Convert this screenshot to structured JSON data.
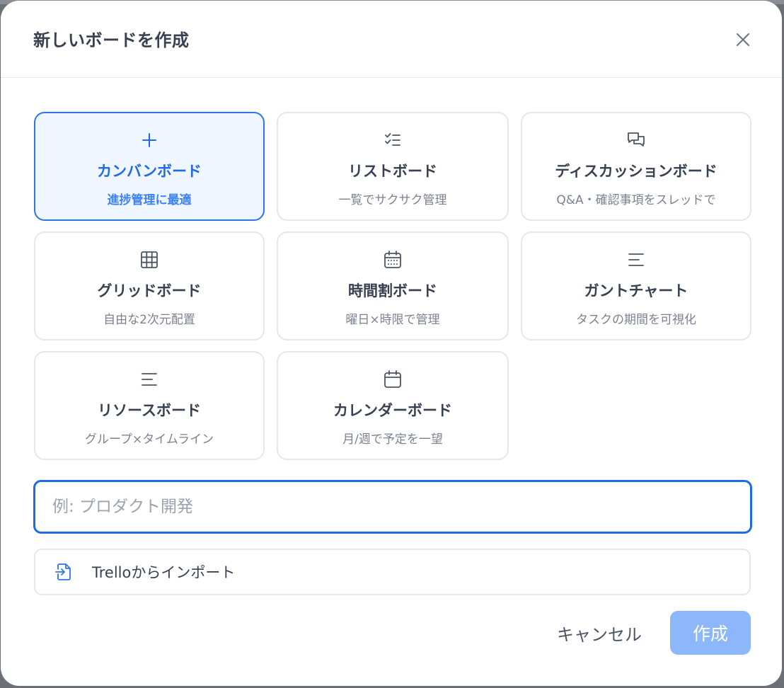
{
  "dialog": {
    "title": "新しいボードを作成"
  },
  "board_types": [
    {
      "title": "カンバンボード",
      "subtitle": "進捗管理に最適",
      "icon": "plus-icon",
      "selected": true
    },
    {
      "title": "リストボード",
      "subtitle": "一覧でサクサク管理",
      "icon": "checklist-icon",
      "selected": false
    },
    {
      "title": "ディスカッションボード",
      "subtitle": "Q&A・確認事項をスレッドで",
      "icon": "chat-bubbles-icon",
      "selected": false
    },
    {
      "title": "グリッドボード",
      "subtitle": "自由な2次元配置",
      "icon": "grid-icon",
      "selected": false
    },
    {
      "title": "時間割ボード",
      "subtitle": "曜日×時限で管理",
      "icon": "calendar-grid-icon",
      "selected": false
    },
    {
      "title": "ガントチャート",
      "subtitle": "タスクの期間を可視化",
      "icon": "gantt-lines-icon",
      "selected": false
    },
    {
      "title": "リソースボード",
      "subtitle": "グループ×タイムライン",
      "icon": "resource-lines-icon",
      "selected": false
    },
    {
      "title": "カレンダーボード",
      "subtitle": "月/週で予定を一望",
      "icon": "calendar-icon",
      "selected": false
    }
  ],
  "name_input": {
    "value": "",
    "placeholder": "例: プロダクト開発"
  },
  "import": {
    "label": "Trelloからインポート",
    "icon": "file-import-icon"
  },
  "footer": {
    "cancel_label": "キャンセル",
    "create_label": "作成"
  },
  "colors": {
    "accent": "#1f6ae6",
    "selected_bg": "#eff6ff",
    "create_disabled": "#8cb8fb"
  }
}
